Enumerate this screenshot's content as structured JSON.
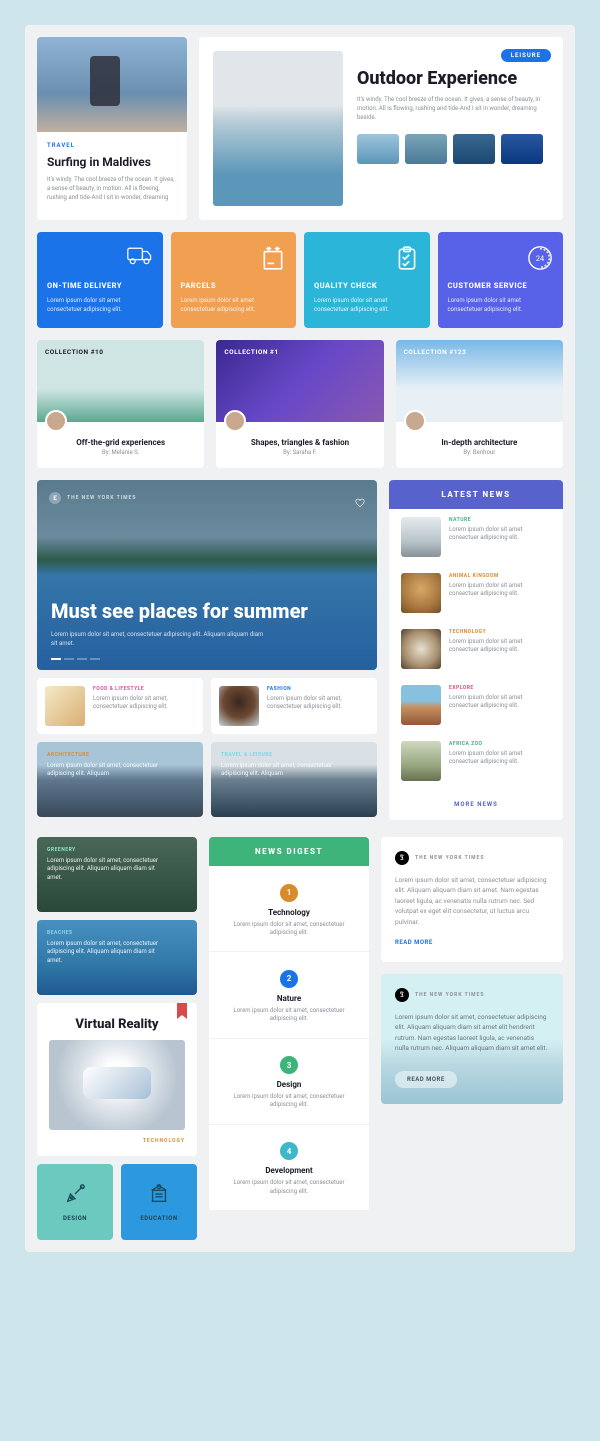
{
  "surf": {
    "category": "TRAVEL",
    "title": "Surfing in Maldives",
    "desc": "It's windy. The cool breeze of the ocean. It gives, a sense of beauty, in motion. All is flowing, rushing and tide-And I sit in wonder, dreaming"
  },
  "outdoor": {
    "tag": "LEISURE",
    "title": "Outdoor Experience",
    "desc": "It's windy. The cool breeze of the ocean. It gives, a sense of beauty, in motion. All is flowing, rushing and tide-And I sit in wonder, dreaming beside."
  },
  "features": [
    {
      "title": "ON-TIME DELIVERY",
      "desc": "Lorem ipsum dolor sit amet consectetuer adipiscing elit.",
      "color": "#1a73e8"
    },
    {
      "title": "PARCELS",
      "desc": "Lorem ipsum dolor sit amet consectetuer adipiscing elit.",
      "color": "#f0a050"
    },
    {
      "title": "QUALITY CHECK",
      "desc": "Lorem ipsum dolor sit amet consectetuer adipiscing elit.",
      "color": "#2bb5d8"
    },
    {
      "title": "CUSTOMER SERVICE",
      "desc": "Lorem ipsum dolor sit amet consectetuer adipiscing elit.",
      "color": "#5862e8"
    }
  ],
  "collections": [
    {
      "label": "COLLECTION #10",
      "title": "Off-the-grid experiences",
      "author": "By: Melanie S.",
      "bg": "linear-gradient(180deg,#cfe5e3 60%,#5ba890)",
      "labelDark": true
    },
    {
      "label": "COLLECTION #1",
      "title": "Shapes, triangles & fashion",
      "author": "By: Saraha F.",
      "bg": "linear-gradient(135deg,#3a2890,#6848c8 50%,#8858b0)"
    },
    {
      "label": "COLLECTION #123",
      "title": "In-depth architecture",
      "author": "By: Benhour",
      "bg": "linear-gradient(180deg,#78b8e8,#e8f0f5 60%)"
    }
  ],
  "hero": {
    "source": "THE NEW YORK TIMES",
    "badge": "E",
    "title": "Must see places for summer",
    "desc": "Lorem ipsum dolor sit amet, consectetuer adipiscing elit. Aliquam aliquam diam sit amet."
  },
  "minis": [
    {
      "category": "FOOD & LIFESTYLE",
      "catColor": "#d94b9b",
      "desc": "Lorem ipsum dolor sit amet, consectetuer adipiscing elit.",
      "img": "linear-gradient(135deg,#f5e8c8,#d8b070)"
    },
    {
      "category": "FASHION",
      "catColor": "#1a73e8",
      "desc": "Lorem ipsum dolor sit amet, consectetuer adipiscing elit.",
      "img": "radial-gradient(circle at 50% 40%,#3a2820,#6b4830 50%,#c8d5da)"
    }
  ],
  "photos": [
    {
      "category": "ARCHITECTURE",
      "catColor": "#d98b2c",
      "desc": "Lorem ipsum dolor sit amet, consectetuer adipiscing elit. Aliquam",
      "bg": "linear-gradient(180deg,#a8c5d8 30%,#607890 50%,#384858)"
    },
    {
      "category": "TRAVEL & LEISURE",
      "catColor": "#78d8e8",
      "desc": "Lorem ipsum dolor sit amet, consectetuer adipiscing elit. Aliquam",
      "bg": "linear-gradient(180deg,#d8e0e5 30%,#6b8090 50%,#2a4050)"
    }
  ],
  "wide": [
    {
      "category": "GREENERY",
      "catColor": "#88e8c0",
      "desc": "Lorem ipsum dolor sit amet, consectetuer adipiscing elit. Aliquam aliquam diam sit amet.",
      "bg": "linear-gradient(180deg,#4a6858,#3a5848 50%,#2a4838)"
    },
    {
      "category": "BEACHES",
      "catColor": "#88d8e8",
      "desc": "Lorem ipsum dolor sit amet, consectetuer adipiscing elit. Aliquam aliquam diam sit amet.",
      "bg": "linear-gradient(180deg,#4890c0,#3078a8 60%,#205890)"
    }
  ],
  "news": {
    "header": "LATEST NEWS",
    "items": [
      {
        "category": "NATURE",
        "catColor": "#3eb37a",
        "desc": "Lorem ipsum dolor sit amet consectuer adipiscing elit.",
        "img": "linear-gradient(180deg,#e5eaed,#b8c5cb 60%,#889098)"
      },
      {
        "category": "ANIMAL KINGDOM",
        "catColor": "#d98b2c",
        "desc": "Lorem ipsum dolor sit amet consectuer adipiscing elit.",
        "img": "radial-gradient(circle at 50% 40%,#d8a868,#a87840 60%,#705028)"
      },
      {
        "category": "TECHNOLOGY",
        "catColor": "#d98b2c",
        "desc": "Lorem ipsum dolor sit amet consectuer adipiscing elit.",
        "img": "radial-gradient(circle at 50% 50%,#e8e0d0,#a89070 60%,#504030)"
      },
      {
        "category": "EXPLORE",
        "catColor": "#e84b7a",
        "desc": "Lorem ipsum dolor sit amet consectuer adipiscing elit.",
        "img": "linear-gradient(180deg,#88c0e0 40%,#c89060 55%,#905838)"
      },
      {
        "category": "AFRICA ZOO",
        "catColor": "#3eb37a",
        "desc": "Lorem ipsum dolor sit amet consectuer adipiscing elit.",
        "img": "linear-gradient(180deg,#d0d8c0,#98a880 60%,#687050)"
      }
    ],
    "more": "MORE NEWS"
  },
  "vr": {
    "title": "Virtual Reality",
    "category": "TECHNOLOGY"
  },
  "iconTiles": [
    {
      "label": "DESIGN",
      "color": "#6cc9c0"
    },
    {
      "label": "EDUCATION",
      "color": "#2c98e0"
    }
  ],
  "digest": {
    "header": "NEWS DIGEST",
    "items": [
      {
        "n": "1",
        "numColor": "#d98b2c",
        "title": "Technology",
        "desc": "Lorem ipsum dolor sit amet, consectetuer adipiscing elit."
      },
      {
        "n": "2",
        "numColor": "#1a73e8",
        "title": "Nature",
        "desc": "Lorem ipsum dolor sit amet, consectetuer adipiscing elit."
      },
      {
        "n": "3",
        "numColor": "#3eb37a",
        "title": "Design",
        "desc": "Lorem ipsum dolor sit amet, consectetuer adipiscing elit."
      },
      {
        "n": "4",
        "numColor": "#3eb8c8",
        "title": "Development",
        "desc": "Lorem ipsum dolor sit amet, consectetuer adipiscing elit."
      }
    ]
  },
  "nyt1": {
    "source": "THE NEW YORK TIMES",
    "desc": "Lorem ipsum dolor sit amet, consectetuer adipiscing elit. Aliquam aliquam diam sit amet. Nam egestas laoreet ligula, ac venenatis nulla rutrum nec. Sed volutpat ex eget elit consectetur, ut luctus arcu pulvinar.",
    "cta": "READ MORE"
  },
  "nyt2": {
    "source": "THE NEW YORK TIMES",
    "desc": "Lorem ipsum dolor sit amet, consectetuer adipiscing elit. Aliquam aliquam diam sit amet elit hendrerit rutrum. Nam egestas laoreet ligula, ac venenatis nulla rutrum nec. Aliquam aliquam diam sit amet elit.",
    "cta": "READ MORE"
  }
}
